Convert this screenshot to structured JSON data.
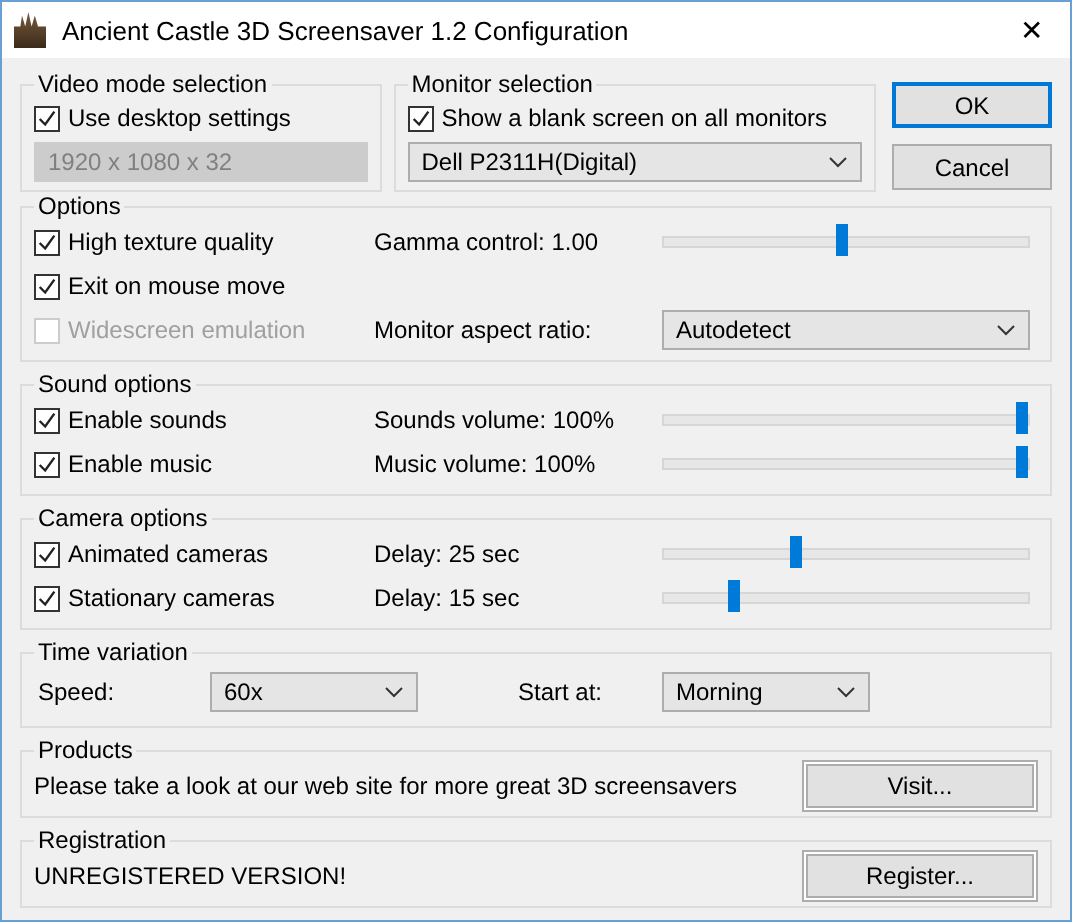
{
  "window": {
    "title": "Ancient Castle 3D Screensaver 1.2 Configuration",
    "close": "✕"
  },
  "video_mode": {
    "title": "Video mode selection",
    "checkbox": {
      "label": "Use desktop settings",
      "checked": true
    },
    "resolution": {
      "value": "1920 x 1080 x 32",
      "disabled": true
    }
  },
  "monitor": {
    "title": "Monitor selection",
    "checkbox": {
      "label": "Show a blank screen on all monitors",
      "checked": true
    },
    "device": {
      "value": "Dell P2311H(Digital)",
      "disabled": false
    }
  },
  "buttons": [
    {
      "label": "OK",
      "default": true
    },
    {
      "label": "Cancel",
      "default": false
    }
  ],
  "sections": [
    {
      "title": "Options",
      "rows": [
        {
          "checkbox": {
            "label": "High texture quality",
            "checked": true,
            "disabled": false
          },
          "control": {
            "kind": "slider",
            "label": "Gamma control: 1.00",
            "level": 0.49
          }
        },
        {
          "checkbox": {
            "label": "Exit on mouse move",
            "checked": true,
            "disabled": false
          }
        },
        {
          "checkbox": {
            "label": "Widescreen emulation",
            "checked": false,
            "disabled": true
          },
          "control": {
            "kind": "select",
            "label": "Monitor aspect ratio:",
            "value": "Autodetect"
          }
        }
      ]
    },
    {
      "title": "Sound options",
      "rows": [
        {
          "checkbox": {
            "label": "Enable sounds",
            "checked": true,
            "disabled": false
          },
          "control": {
            "kind": "slider",
            "label": "Sounds volume: 100%",
            "level": 1
          }
        },
        {
          "checkbox": {
            "label": "Enable music",
            "checked": true,
            "disabled": false
          },
          "control": {
            "kind": "slider",
            "label": "Music volume: 100%",
            "level": 1
          }
        }
      ]
    },
    {
      "title": "Camera options",
      "rows": [
        {
          "checkbox": {
            "label": "Animated cameras",
            "checked": true,
            "disabled": false
          },
          "control": {
            "kind": "slider",
            "label": "Delay: 25 sec",
            "level": 0.36
          }
        },
        {
          "checkbox": {
            "label": "Stationary cameras",
            "checked": true,
            "disabled": false
          },
          "control": {
            "kind": "slider",
            "label": "Delay: 15 sec",
            "level": 0.18
          }
        }
      ]
    }
  ],
  "time_variation": {
    "title": "Time variation",
    "speed": {
      "label": "Speed:",
      "value": "60x"
    },
    "start": {
      "label": "Start at:",
      "value": "Morning"
    }
  },
  "products": {
    "title": "Products",
    "text": "Please take a look at our web site for more great 3D screensavers",
    "button": "Visit..."
  },
  "registration": {
    "title": "Registration",
    "text": "UNREGISTERED VERSION!",
    "button": "Register..."
  }
}
